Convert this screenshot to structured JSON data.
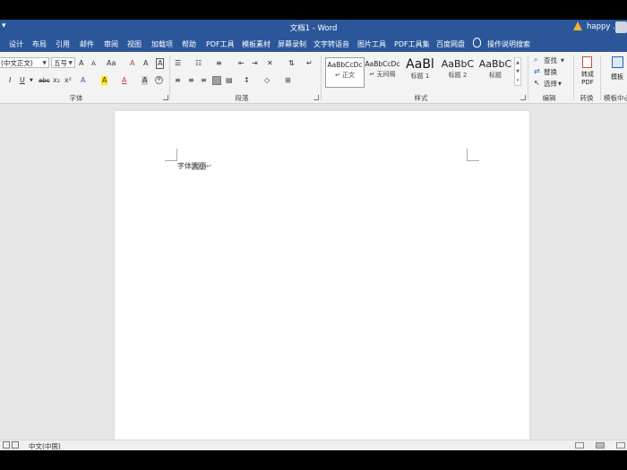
{
  "window": {
    "title": "文档1 - Word",
    "user_name": "happy .",
    "qat_glyph": "▾"
  },
  "tabs": [
    "设计",
    "布局",
    "引用",
    "邮件",
    "审阅",
    "视图",
    "加载项",
    "帮助",
    "PDF工具",
    "模板素材",
    "屏幕录制",
    "文字转语音",
    "图片工具",
    "PDF工具集",
    "百度网盘"
  ],
  "tell_me": "操作说明搜索",
  "ribbon": {
    "font": {
      "font_name": "(中文正文)",
      "font_size": "五号",
      "group_label": "字体",
      "row1_icons": [
        "A",
        "A",
        "Aa",
        "A",
        "A"
      ],
      "row2_icons": [
        "I",
        "U",
        "abc",
        "x₂",
        "x²",
        "A",
        "A",
        "A",
        "A"
      ]
    },
    "paragraph": {
      "group_label": "段落"
    },
    "styles": {
      "group_label": "样式",
      "items": [
        {
          "sample": "AaBbCcDc",
          "name": "↵ 正文"
        },
        {
          "sample": "AaBbCcDc",
          "name": "↵ 无间隔"
        },
        {
          "sample": "AaBl",
          "name": "标题 1"
        },
        {
          "sample": "AaBbC",
          "name": "标题 2"
        },
        {
          "sample": "AaBbC",
          "name": "标题"
        }
      ]
    },
    "editing": {
      "group_label": "编辑",
      "find": "查找",
      "replace": "替换",
      "select": "选择"
    },
    "convert": {
      "group_label": "转换",
      "button_label": "转成PDF"
    },
    "template": {
      "group_label": "模板中心",
      "button_label": "模板"
    }
  },
  "document": {
    "text_plain": "字体",
    "text_selected": "大小",
    "para_mark": "↵"
  },
  "status": {
    "language": "中文(中国)"
  },
  "colors": {
    "title_blue": "#2b579a",
    "ribbon_bg": "#f3f3f3",
    "canvas_bg": "#e6e6e6",
    "warn": "#f2b233"
  }
}
